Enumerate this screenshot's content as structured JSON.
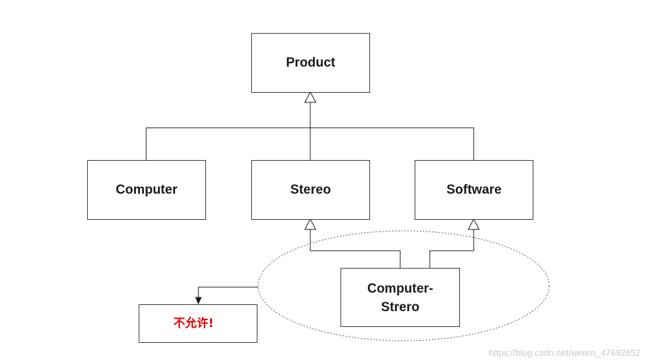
{
  "diagram": {
    "nodes": {
      "product": {
        "label": "Product"
      },
      "computer": {
        "label": "Computer"
      },
      "stereo": {
        "label": "Stereo"
      },
      "software": {
        "label": "Software"
      },
      "computer_stereo": {
        "line1": "Computer-",
        "line2": "Strero"
      },
      "not_allowed": {
        "label": "不允许!"
      }
    }
  },
  "colors": {
    "line": "#1a1a1a",
    "warning_text": "#e00000",
    "watermark": "#c8c8c8"
  },
  "watermark": {
    "text": "https://blog.csdn.net/weixin_47692652"
  }
}
